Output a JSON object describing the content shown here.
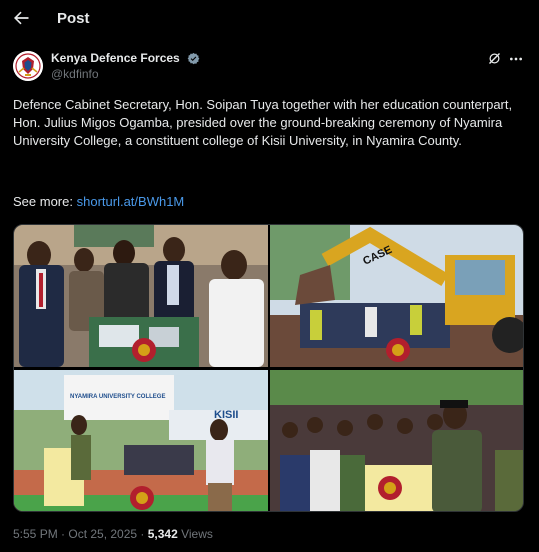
{
  "header": {
    "title": "Post"
  },
  "author": {
    "name": "Kenya Defence Forces",
    "handle": "@kdfinfo"
  },
  "post": {
    "text": "Defence Cabinet Secretary, Hon. Soipan Tuya together with her education counterpart, Hon. Julius Migos Ogamba, presided over the ground-breaking ceremony of Nyamira University College, a constituent college of Kisii University, in Nyamira County.",
    "see_more_label": "See more:",
    "link": "shorturl.at/BWh1M"
  },
  "media": {
    "photos": [
      {
        "name": "officials-viewing-model",
        "banner_text": ""
      },
      {
        "name": "backhoe-groundbreaking",
        "machine_text": "CASE"
      },
      {
        "name": "stage-with-podium",
        "banner_text": "NYAMIRA UNIVERSITY COLLEGE",
        "logo_text": "KISII"
      },
      {
        "name": "speaker-at-podium",
        "banner_text": ""
      }
    ]
  },
  "meta": {
    "time": "5:55 PM · Oct 25, 2025 · ",
    "views_count": "5,342",
    "views_label": " Views"
  },
  "colors": {
    "background": "#000000",
    "text": "#e7e9ea",
    "muted": "#71767b",
    "link": "#4a99e9",
    "verified": "#829aab"
  }
}
